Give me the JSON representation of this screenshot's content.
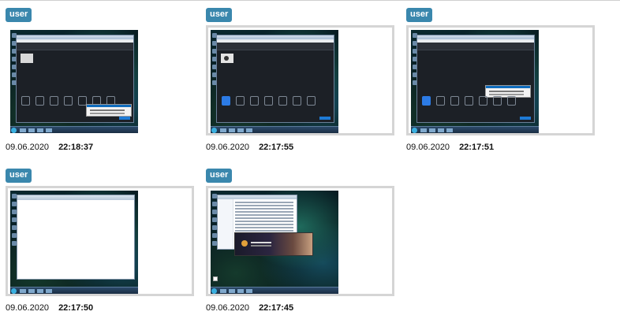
{
  "screens": [
    {
      "user": "user",
      "date": "09.06.2020",
      "time": "22:18:37",
      "app": "converter-idle",
      "selected": false
    },
    {
      "user": "user",
      "date": "09.06.2020",
      "time": "22:17:55",
      "app": "converter-file",
      "selected": true
    },
    {
      "user": "user",
      "date": "09.06.2020",
      "time": "22:17:51",
      "app": "converter-dialog",
      "selected": true
    },
    {
      "user": "user",
      "date": "09.06.2020",
      "time": "22:17:50",
      "app": "blank-window",
      "selected": true
    },
    {
      "user": "user",
      "date": "09.06.2020",
      "time": "22:17:45",
      "app": "explorer-splash",
      "selected": true
    }
  ],
  "colors": {
    "badge": "#3a87ad",
    "frame": "#d5d5d5",
    "accent": "#2c7be5"
  }
}
